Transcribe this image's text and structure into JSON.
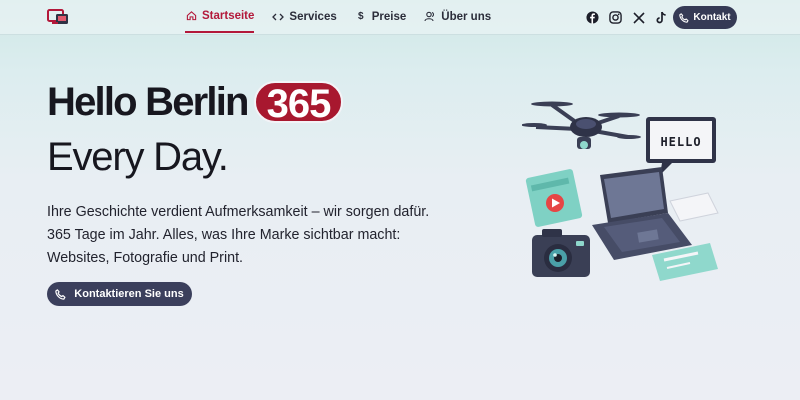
{
  "header": {
    "nav": [
      {
        "label": "Startseite",
        "icon": "home-icon",
        "active": true
      },
      {
        "label": "Services",
        "icon": "code-icon",
        "active": false
      },
      {
        "label": "Preise",
        "icon": "dollar-icon",
        "active": false
      },
      {
        "label": "Über uns",
        "icon": "users-icon",
        "active": false
      }
    ],
    "socials": [
      "facebook-icon",
      "instagram-icon",
      "x-icon",
      "tiktok-icon"
    ],
    "contact_label": "Kontakt"
  },
  "hero": {
    "title_part1": "Hello Berlin",
    "title_badge": "365",
    "title_line2": "Every Day.",
    "lead_lines": [
      "Ihre Geschichte verdient Aufmerksamkeit – wir sorgen dafür.",
      "365 Tage im Jahr. Alles, was Ihre Marke sichtbar macht:",
      "Websites, Fotografie und Print."
    ],
    "cta_label": "Kontaktieren Sie uns"
  },
  "illustration": {
    "monitor_text": "HELLO"
  },
  "colors": {
    "accent": "#b3183a",
    "badge": "#a8182f",
    "button": "#353a55",
    "teal": "#7fd1c4"
  }
}
